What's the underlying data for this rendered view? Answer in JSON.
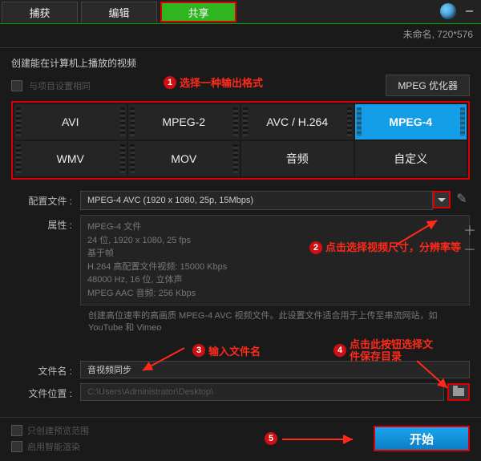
{
  "tabs": {
    "capture": "捕获",
    "edit": "编辑",
    "share": "共享"
  },
  "status": {
    "doc": "未命名, 720*576"
  },
  "section_title": "创建能在计算机上播放的视频",
  "project_settings_label": "与项目设置相同",
  "optimizer_label": "MPEG 优化器",
  "callouts": {
    "c1": "选择一种输出格式",
    "c2": "点击选择视频尺寸，分辨率等",
    "c3": "输入文件名",
    "c4": "点击此按钮选择文件保存目录"
  },
  "formats": {
    "avi": "AVI",
    "mpeg2": "MPEG-2",
    "avc": "AVC / H.264",
    "mpeg4": "MPEG-4",
    "wmv": "WMV",
    "mov": "MOV",
    "audio": "音频",
    "custom": "自定义"
  },
  "labels": {
    "profile": "配置文件 :",
    "attributes": "属性 :",
    "filename": "文件名 :",
    "filepath": "文件位置 :",
    "preview_only": "只创建预览范围",
    "smart_render": "启用智能渲染"
  },
  "profile_value": "MPEG-4 AVC (1920 x 1080, 25p, 15Mbps)",
  "attributes_text": "MPEG-4 文件\n24 位, 1920 x 1080, 25 fps\n基于帧\nH.264 高配置文件视频: 15000 Kbps\n48000 Hz, 16 位, 立体声\nMPEG AAC 音频: 256 Kbps",
  "attr_desc": "创建高位速率的高画质 MPEG-4 AVC 视频文件。此设置文件适合用于上传至串流网站，如 YouTube 和 Vimeo",
  "filename_value": "音视频同步",
  "filepath_value": "C:\\Users\\Administrator\\Desktop\\",
  "start_label": "开始"
}
